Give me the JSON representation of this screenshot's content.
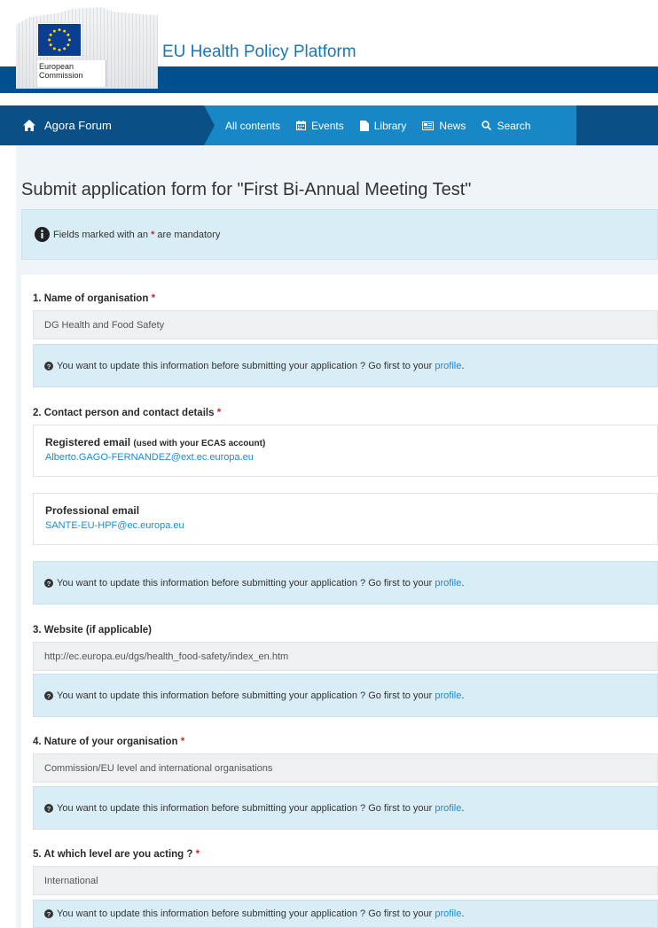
{
  "header": {
    "logo_text_line1": "European",
    "logo_text_line2": "Commission",
    "site_title": "EU Health Policy Platform"
  },
  "nav": {
    "home_label": "Agora Forum",
    "items": [
      {
        "label": "All contents",
        "icon": ""
      },
      {
        "label": "Events",
        "icon": "calendar-icon"
      },
      {
        "label": "Library",
        "icon": "file-icon"
      },
      {
        "label": "News",
        "icon": "newspaper-icon"
      },
      {
        "label": "Search",
        "icon": "search-icon"
      }
    ]
  },
  "page": {
    "title": "Submit application form for \"First Bi-Annual Meeting Test\"",
    "mandatory_prefix": "Fields marked with an",
    "mandatory_star": "*",
    "mandatory_suffix": "are mandatory"
  },
  "notice": {
    "text": "You want to update this information before submitting your application ? Go first to your",
    "link": "profile",
    "end": "."
  },
  "form": {
    "q1": {
      "label": "1. Name of organisation",
      "star": "*",
      "value": "DG Health and Food Safety"
    },
    "q2": {
      "label": "2. Contact person and contact details",
      "star": "*",
      "registered_title": "Registered email",
      "registered_note": "(used with your ECAS account)",
      "registered_value": "Alberto.GAGO-FERNANDEZ@ext.ec.europa.eu",
      "professional_title": "Professional email",
      "professional_value": "SANTE-EU-HPF@ec.europa.eu"
    },
    "q3": {
      "label": "3. Website (if applicable)",
      "value": "http://ec.europa.eu/dgs/health_food-safety/index_en.htm"
    },
    "q4": {
      "label": "4. Nature of your organisation",
      "star": "*",
      "value": "Commission/EU level and international organisations"
    },
    "q5": {
      "label": "5. At which level are you acting ?",
      "star": "*",
      "value": "International"
    }
  },
  "colors": {
    "nav_dark": "#0a4f86",
    "nav_accent": "#1787c5",
    "link": "#1a8ad4",
    "info_bg": "#d9edf7",
    "required": "#d9242b"
  }
}
